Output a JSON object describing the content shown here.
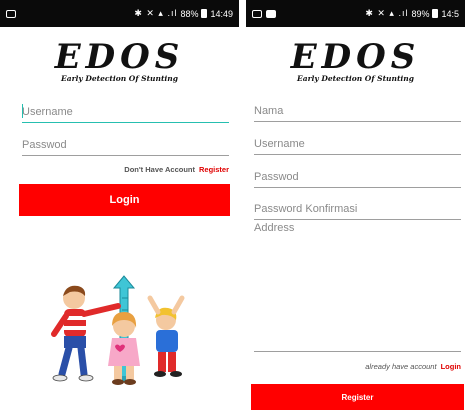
{
  "status_left": {
    "battery_pct": "88%",
    "time": "14:49"
  },
  "status_right": {
    "battery_pct": "89%",
    "time": "14:5"
  },
  "logo": {
    "title": "EDOS",
    "subtitle": "Early Detection Of Stunting"
  },
  "login": {
    "username_placeholder": "Username",
    "password_placeholder": "Passwod",
    "no_account_text": "Don't Have Account",
    "register_link": "Register",
    "login_button": "Login"
  },
  "register": {
    "name_placeholder": "Nama",
    "username_placeholder": "Username",
    "password_placeholder": "Passwod",
    "password_confirm_placeholder": "Password Konfirmasi",
    "address_placeholder": "Address",
    "have_account_text": "already have account",
    "login_link": "Login",
    "register_button": "Register"
  },
  "colors": {
    "accent_red": "#ff0000",
    "link_red": "#e00000",
    "focus_teal": "#26bfb0"
  }
}
